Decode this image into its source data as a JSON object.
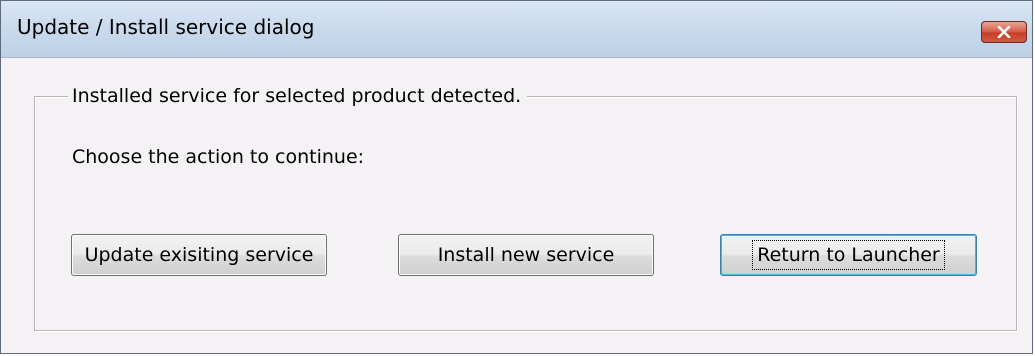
{
  "window": {
    "title": "Update / Install service dialog"
  },
  "titlebar": {
    "close_icon": "close-icon"
  },
  "group": {
    "legend": "Installed service for selected product detected."
  },
  "content": {
    "instruction": "Choose the action to continue:"
  },
  "buttons": {
    "update_label": "Update exisiting service",
    "install_label": "Install new service",
    "return_label": "Return to Launcher"
  },
  "colors": {
    "close_button": "#c4402a",
    "titlebar": "#c8d9ec",
    "dialog_background": "#f5f2f5"
  }
}
